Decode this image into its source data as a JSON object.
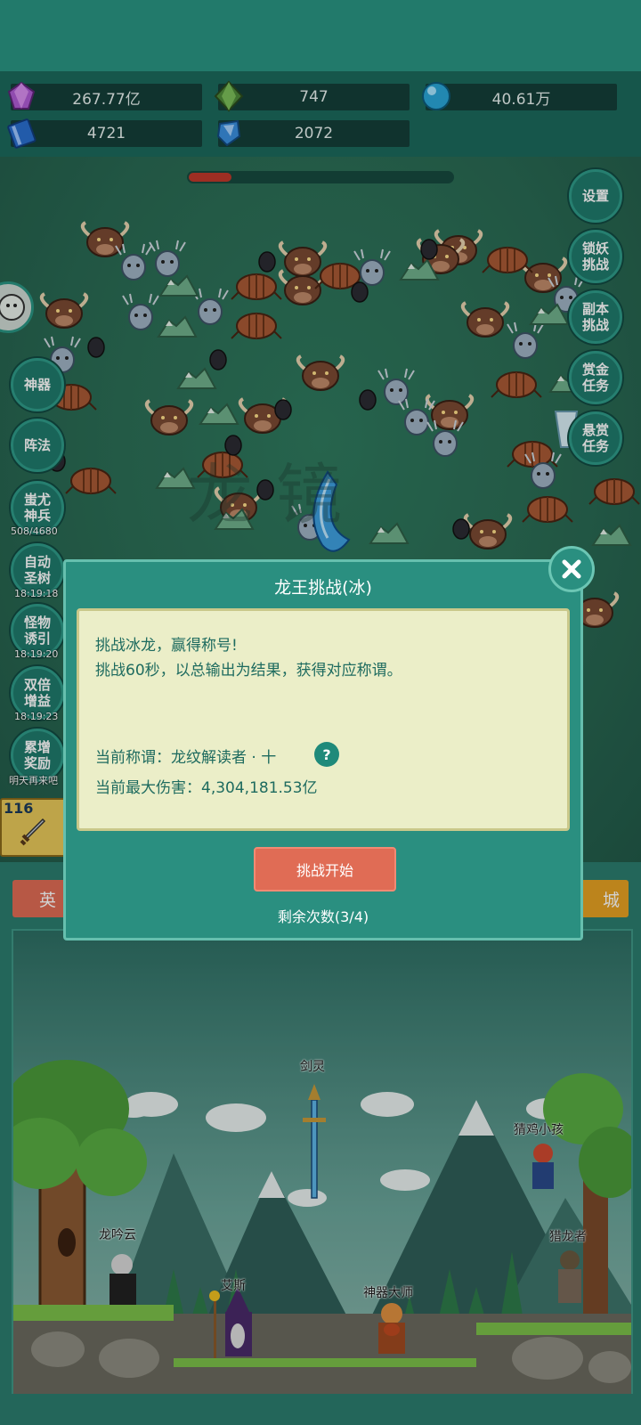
{
  "resources": [
    {
      "icon": "purple-gem-icon",
      "value": "267.77亿"
    },
    {
      "icon": "green-crystal-icon",
      "value": "747"
    },
    {
      "icon": "blue-orb-icon",
      "value": "40.61万"
    },
    {
      "icon": "blue-book-icon",
      "value": "4721"
    },
    {
      "icon": "blue-shard-icon",
      "value": "2072"
    }
  ],
  "right_menu": [
    "设置",
    "锁妖挑战",
    "副本挑战",
    "赏金任务",
    "悬赏任务"
  ],
  "left_menu": [
    {
      "label": "神器"
    },
    {
      "label": "阵法"
    },
    {
      "label": "蚩尤神兵",
      "sub": "508/4680"
    },
    {
      "label": "自动圣树",
      "sub": "18:19:18"
    },
    {
      "label": "怪物诱引",
      "sub": "18:19:20"
    },
    {
      "label": "双倍增益",
      "sub": "18:19:23"
    },
    {
      "label": "累增奖励",
      "sub": "明天再来吧"
    }
  ],
  "level_badge": "116",
  "tabs": {
    "left": "英",
    "right": "城"
  },
  "watermark": "龙镜",
  "modal": {
    "title": "龙王挑战(冰)",
    "desc_line1": "挑战冰龙，赢得称号!",
    "desc_line2": "挑战60秒，以总输出为结果，获得对应称谓。",
    "current_title_label": "当前称谓：龙纹解读者 · 十",
    "max_damage_label": "当前最大伤害：4,304,181.53亿",
    "help_icon": "?",
    "start_button": "挑战开始",
    "remaining": "剩余次数(3/4)"
  },
  "heroes": [
    "剑灵",
    "猜鸡小孩",
    "龙吟云",
    "猎龙者",
    "艾斯",
    "神器大师"
  ],
  "colors": {
    "accent": "#2a8f80",
    "start_button": "#e06c55",
    "panel": "#ebeec8"
  }
}
